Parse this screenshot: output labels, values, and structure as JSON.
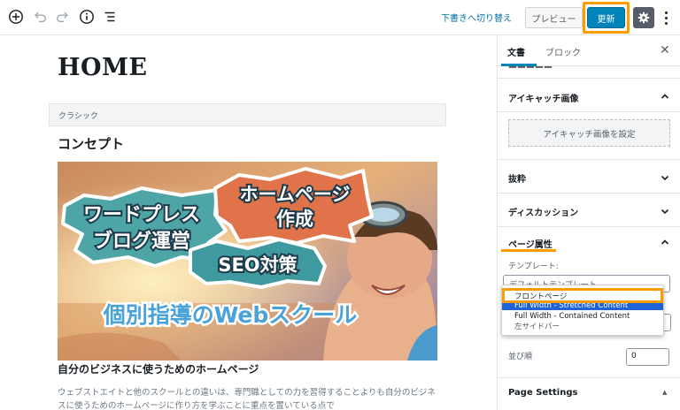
{
  "toolbar": {
    "icons": [
      "add-block-icon",
      "undo-icon",
      "redo-icon",
      "info-icon",
      "block-navigation-icon"
    ],
    "switch_to_draft": "下書きへ切り替え",
    "preview": "プレビュー",
    "update": "更新",
    "settings_icon": "gear-icon",
    "more_icon": "more-vertical-icon"
  },
  "editor": {
    "title": "HOME",
    "classic_label": "クラシック",
    "heading": "コンセプト",
    "hero": {
      "bubble1_line1": "ワードプレス",
      "bubble1_line2": "ブログ運営",
      "bubble2_line1": "ホームページ",
      "bubble2_line2": "作成",
      "bubble3": "SEO対策",
      "banner": "個別指導のWebスクール"
    },
    "sub_heading": "自分のビジネスに使うためのホームページ",
    "paragraph": "ウェブストエイトと他のスクールとの違いは、専門職としての力を習得することよりも自分のビジネスに使うためのホームページに作り方を学ぶことに重点を置いている点で"
  },
  "sidebar": {
    "tabs": {
      "document": "文書",
      "block": "ブロック"
    },
    "close_icon": "close-icon",
    "panels": {
      "featured_image": "アイキャッチ画像",
      "featured_image_button": "アイキャッチ画像を設定",
      "excerpt": "抜粋",
      "discussion": "ディスカッション",
      "page_attributes": "ページ属性",
      "page_settings": "Page Settings"
    },
    "template_label": "テンプレート:",
    "template_selected": "デフォルトテンプレート",
    "template_options": [
      "フロントページ",
      "Full Width - Stretched Content",
      "Full Width - Contained Content",
      "左サイドバー"
    ],
    "order_label": "並び順",
    "order_value": "0"
  },
  "colors": {
    "accent": "#0085ba",
    "highlight": "#ff9c00",
    "link": "#0073aa"
  }
}
